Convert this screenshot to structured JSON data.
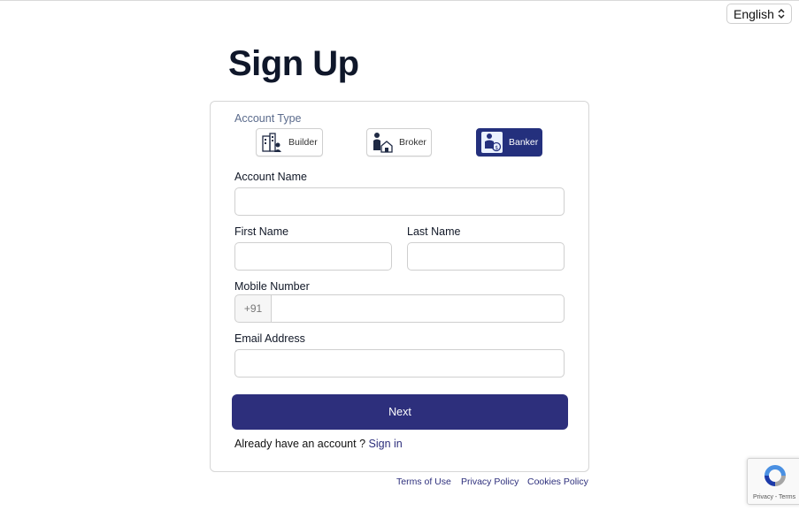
{
  "language": {
    "selected": "English"
  },
  "page": {
    "title": "Sign Up"
  },
  "form": {
    "account_type_label": "Account Type",
    "account_types": [
      {
        "label": "Builder",
        "icon": "builder-icon",
        "active": false
      },
      {
        "label": "Broker",
        "icon": "broker-icon",
        "active": false
      },
      {
        "label": "Banker",
        "icon": "banker-icon",
        "active": true
      }
    ],
    "account_name_label": "Account Name",
    "account_name_value": "",
    "first_name_label": "First Name",
    "first_name_value": "",
    "last_name_label": "Last Name",
    "last_name_value": "",
    "mobile_label": "Mobile Number",
    "mobile_prefix": "+91",
    "mobile_value": "",
    "email_label": "Email Address",
    "email_value": "",
    "next_label": "Next",
    "signin_prompt": "Already have an account ?",
    "signin_link": "Sign in"
  },
  "footer": {
    "terms": "Terms of Use",
    "privacy": "Privacy Policy",
    "cookies": "Cookies Policy"
  },
  "recaptcha": {
    "text": "Privacy - Terms"
  },
  "colors": {
    "primary": "#2d2f7c",
    "active_type": "#24307d"
  }
}
